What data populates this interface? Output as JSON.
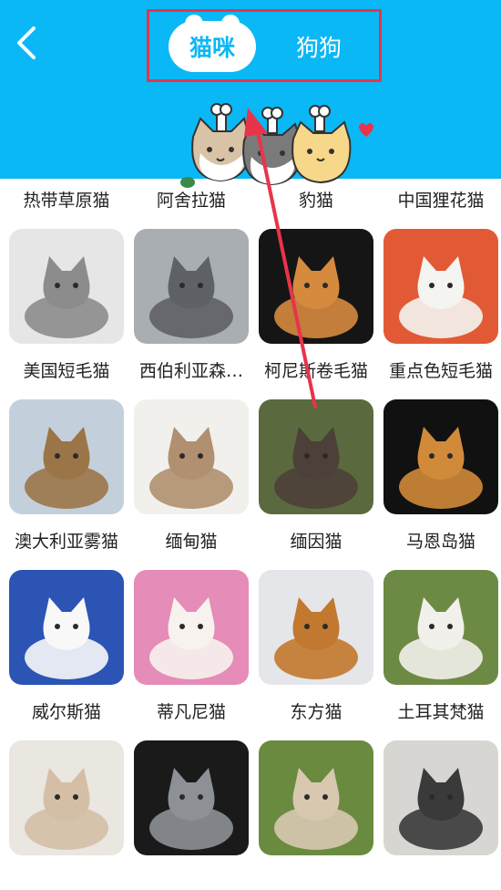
{
  "header": {
    "tabs": [
      {
        "label": "猫咪",
        "selected": true
      },
      {
        "label": "狗狗",
        "selected": false
      }
    ],
    "icons": {
      "back": "chevron-left-icon",
      "mascot": "cats-mascot-illustration"
    },
    "colors": {
      "header_bg": "#0ab8f5",
      "highlight_border": "#e8344a",
      "annotation_arrow": "#e8344a"
    }
  },
  "breeds": [
    {
      "name": "热带草原猫",
      "bg": "#cdb79a",
      "fg": "#6b4a2a"
    },
    {
      "name": "阿舍拉猫",
      "bg": "#b5202a",
      "fg": "#c9a27a"
    },
    {
      "name": "豹猫",
      "bg": "#5a6b52",
      "fg": "#8a7458"
    },
    {
      "name": "中国狸花猫",
      "bg": "#d8c6a6",
      "fg": "#8a6f4a"
    },
    {
      "name": "美国短毛猫",
      "bg": "#e6e6e6",
      "fg": "#8c8c8c"
    },
    {
      "name": "西伯利亚森…",
      "bg": "#a9aeb3",
      "fg": "#5e6166"
    },
    {
      "name": "柯尼斯卷毛猫",
      "bg": "#151515",
      "fg": "#d58a3e"
    },
    {
      "name": "重点色短毛猫",
      "bg": "#e25a35",
      "fg": "#f4f4f0"
    },
    {
      "name": "澳大利亚雾猫",
      "bg": "#c3d0dc",
      "fg": "#9b7548"
    },
    {
      "name": "缅甸猫",
      "bg": "#f2f0ec",
      "fg": "#b09070"
    },
    {
      "name": "缅因猫",
      "bg": "#5a6a3e",
      "fg": "#4c4038"
    },
    {
      "name": "马恩岛猫",
      "bg": "#111111",
      "fg": "#d08a3a"
    },
    {
      "name": "威尔斯猫",
      "bg": "#2b54b5",
      "fg": "#f8f8f8"
    },
    {
      "name": "蒂凡尼猫",
      "bg": "#e58cb8",
      "fg": "#f7f2ee"
    },
    {
      "name": "东方猫",
      "bg": "#e4e6ea",
      "fg": "#c2782e"
    },
    {
      "name": "土耳其梵猫",
      "bg": "#6d8a45",
      "fg": "#f2f0ea"
    },
    {
      "name": "",
      "bg": "#eae6e0",
      "fg": "#d4bfa6"
    },
    {
      "name": "",
      "bg": "#1a1a1a",
      "fg": "#8d9196"
    },
    {
      "name": "",
      "bg": "#6a8a40",
      "fg": "#d8c8b0"
    },
    {
      "name": "",
      "bg": "#d8d6d2",
      "fg": "#3a3a3a"
    }
  ]
}
